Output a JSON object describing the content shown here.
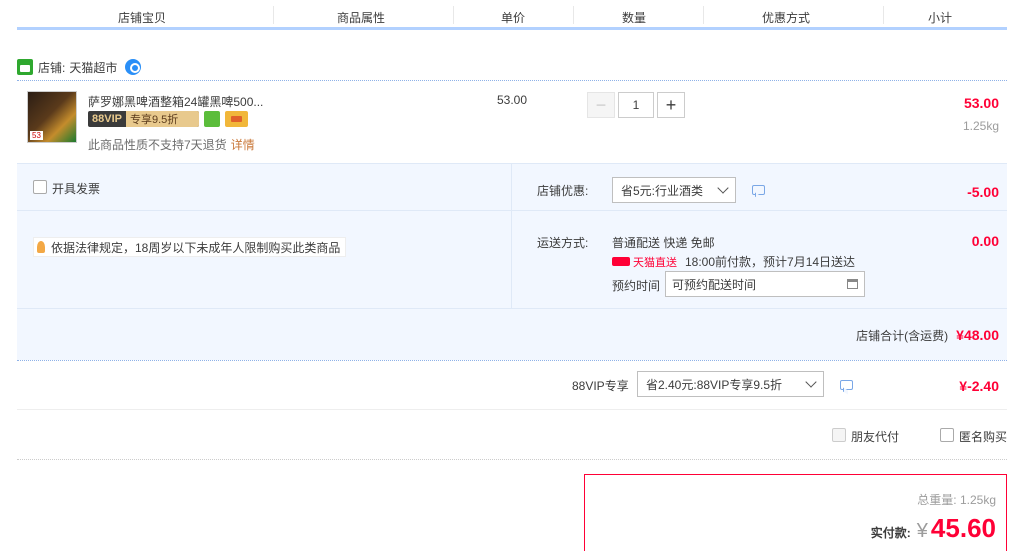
{
  "header": {
    "col_item": "店铺宝贝",
    "col_attr": "商品属性",
    "col_price": "单价",
    "col_qty": "数量",
    "col_discount": "优惠方式",
    "col_subtotal": "小计"
  },
  "shop": {
    "label": "店铺:",
    "name": "天猫超市"
  },
  "item": {
    "title": "萨罗娜黑啤酒整箱24罐黑啤500...",
    "vip_left": "88VIP",
    "vip_right": "专享9.5折",
    "no_return": "此商品性质不支持7天退货",
    "detail_link": "详情",
    "thumb_badge": "53",
    "unit_price": "53.00",
    "qty": "1",
    "qty_minus": "−",
    "qty_plus": "+",
    "subtotal": "53.00",
    "weight": "1.25kg"
  },
  "options": {
    "invoice_label": "开具发票",
    "notice": "依据法律规定，18周岁以下未成年人限制购买此类商品",
    "shop_discount_label": "店铺优惠:",
    "shop_discount_value": "省5元:行业酒类",
    "shop_discount_amount": "-5.00",
    "shipping_label": "运送方式:",
    "shipping_method": "普通配送 快递 免邮",
    "shipping_amount": "0.00",
    "tmall_direct": "天猫直送",
    "delivery_note": "18:00前付款，预计7月14日送达",
    "reserve_label": "预约时间",
    "reserve_placeholder": "可预约配送时间",
    "shop_total_label": "店铺合计(含运费)",
    "shop_total_value": "¥48.00"
  },
  "vip": {
    "label": "88VIP专享",
    "value": "省2.40元:88VIP专享9.5折",
    "amount": "¥-2.40"
  },
  "extra": {
    "friend_pay": "朋友代付",
    "anonymous": "匿名购买"
  },
  "summary": {
    "weight_label": "总重量: 1.25kg",
    "pay_label": "实付款:",
    "currency": "¥",
    "amount": "45.60"
  },
  "colors": {
    "accent": "#ff0036",
    "header_line": "#b2d1ff",
    "panel_bg": "#f2f7ff"
  }
}
